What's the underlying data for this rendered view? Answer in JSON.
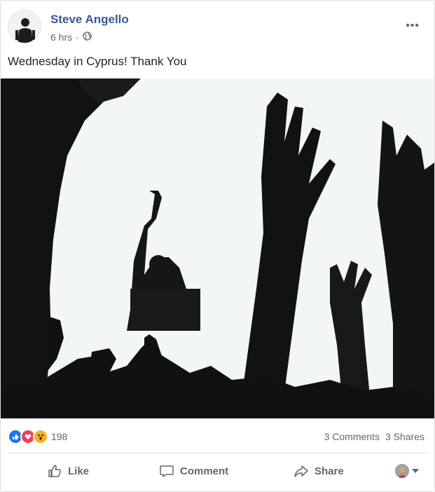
{
  "post": {
    "author": "Steve Angello",
    "time": "6 hrs",
    "separator": "·",
    "audience_icon": "globe-icon",
    "text": "Wednesday in Cyprus! Thank You",
    "more_icon": "more-icon",
    "more_label": "•••"
  },
  "reactions": {
    "types": [
      "like",
      "love",
      "wow"
    ],
    "count": "198",
    "comments": "3 Comments",
    "shares": "3 Shares"
  },
  "actions": {
    "like": "Like",
    "comment": "Comment",
    "share": "Share"
  },
  "colors": {
    "link": "#385898",
    "muted": "#606770",
    "like": "#1877f2",
    "love": "#f33e58",
    "wow": "#f7b125"
  }
}
